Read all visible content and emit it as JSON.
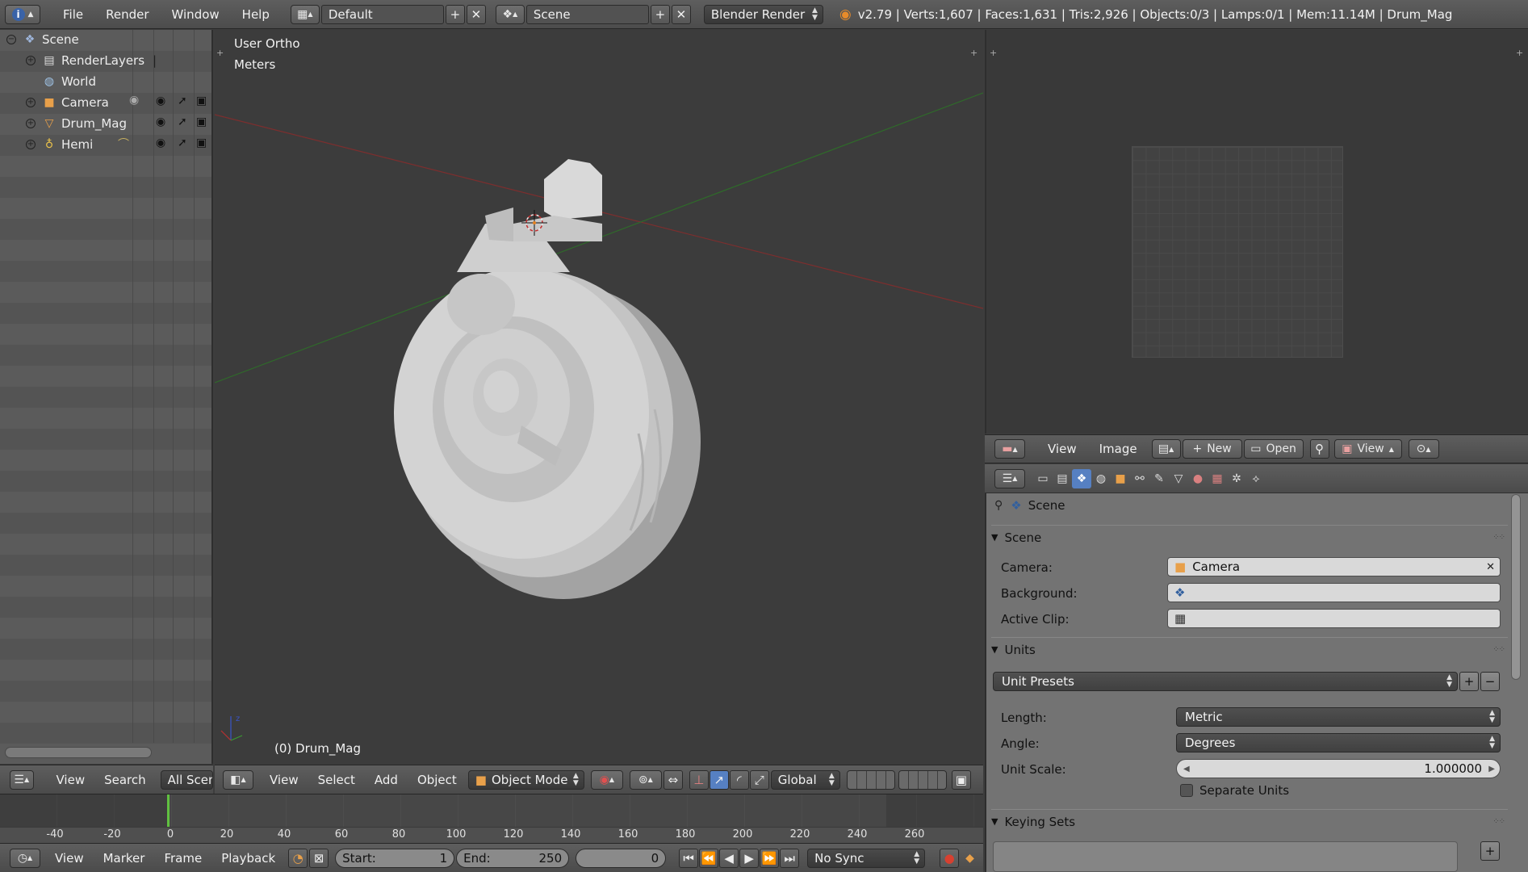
{
  "topbar": {
    "menus": [
      "File",
      "Render",
      "Window",
      "Help"
    ],
    "screen_layout": "Default",
    "scene_name": "Scene",
    "render_engine": "Blender Render",
    "stats": "v2.79 | Verts:1,607 | Faces:1,631 | Tris:2,926 | Objects:0/3 | Lamps:0/1 | Mem:11.14M | Drum_Mag"
  },
  "outliner": {
    "items": [
      {
        "label": "Scene",
        "icon": "scene-icon"
      },
      {
        "label": "RenderLayers",
        "icon": "render-layers-icon"
      },
      {
        "label": "World",
        "icon": "world-icon"
      },
      {
        "label": "Camera",
        "icon": "camera-object-icon"
      },
      {
        "label": "Drum_Mag",
        "icon": "mesh-icon"
      },
      {
        "label": "Hemi",
        "icon": "lamp-icon"
      }
    ],
    "header": {
      "view": "View",
      "search": "Search",
      "filter": "All Scenes"
    }
  },
  "viewport": {
    "view_name": "User Ortho",
    "units": "Meters",
    "object_label": "(0) Drum_Mag",
    "header": {
      "menus": [
        "View",
        "Select",
        "Add",
        "Object"
      ],
      "mode": "Object Mode",
      "orientation": "Global"
    }
  },
  "image_editor": {
    "header": {
      "view": "View",
      "image": "Image",
      "new": "New",
      "open": "Open",
      "view2": "View"
    }
  },
  "properties": {
    "breadcrumb": "Scene",
    "scene_panel": {
      "title": "Scene",
      "camera_label": "Camera:",
      "camera_value": "Camera",
      "background_label": "Background:",
      "active_clip_label": "Active Clip:"
    },
    "units_panel": {
      "title": "Units",
      "presets": "Unit Presets",
      "length_label": "Length:",
      "length_value": "Metric",
      "angle_label": "Angle:",
      "angle_value": "Degrees",
      "scale_label": "Unit Scale:",
      "scale_value": "1.000000",
      "separate_units": "Separate Units"
    },
    "keying_panel": {
      "title": "Keying Sets"
    }
  },
  "timeline": {
    "ticks": [
      "-40",
      "-20",
      "0",
      "20",
      "40",
      "60",
      "80",
      "100",
      "120",
      "140",
      "160",
      "180",
      "200",
      "220",
      "240",
      "260"
    ],
    "header": {
      "menus": [
        "View",
        "Marker",
        "Frame",
        "Playback"
      ],
      "start_label": "Start:",
      "start_value": "1",
      "end_label": "End:",
      "end_value": "250",
      "current_frame": "0",
      "sync": "No Sync"
    }
  },
  "colors": {
    "x_axis": "#8a2f2f",
    "y_axis": "#3f7a2f",
    "current_frame": "#60c040",
    "active_tab": "#5680c2"
  }
}
